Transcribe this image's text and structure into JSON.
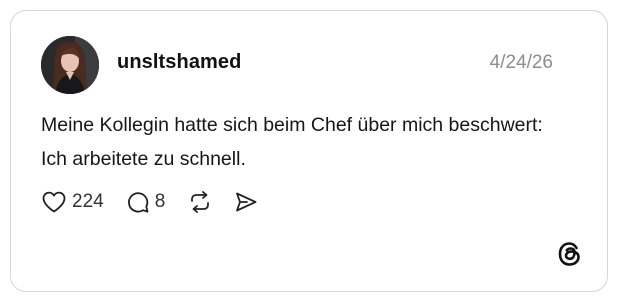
{
  "post": {
    "username": "unsltshamed",
    "date": "4/24/26",
    "text": "Meine Kollegin hatte sich beim Chef über mich beschwert: Ich arbeitete zu schnell.",
    "likes": "224",
    "comments": "8"
  },
  "icons": {
    "like": "heart-icon",
    "comment": "comment-bubble-icon",
    "repost": "repost-icon",
    "share": "send-icon",
    "logo": "threads-logo-icon"
  },
  "colors": {
    "border": "#d6d6d6",
    "date": "#8d8d8d",
    "text": "#161616",
    "icon": "#222222"
  }
}
